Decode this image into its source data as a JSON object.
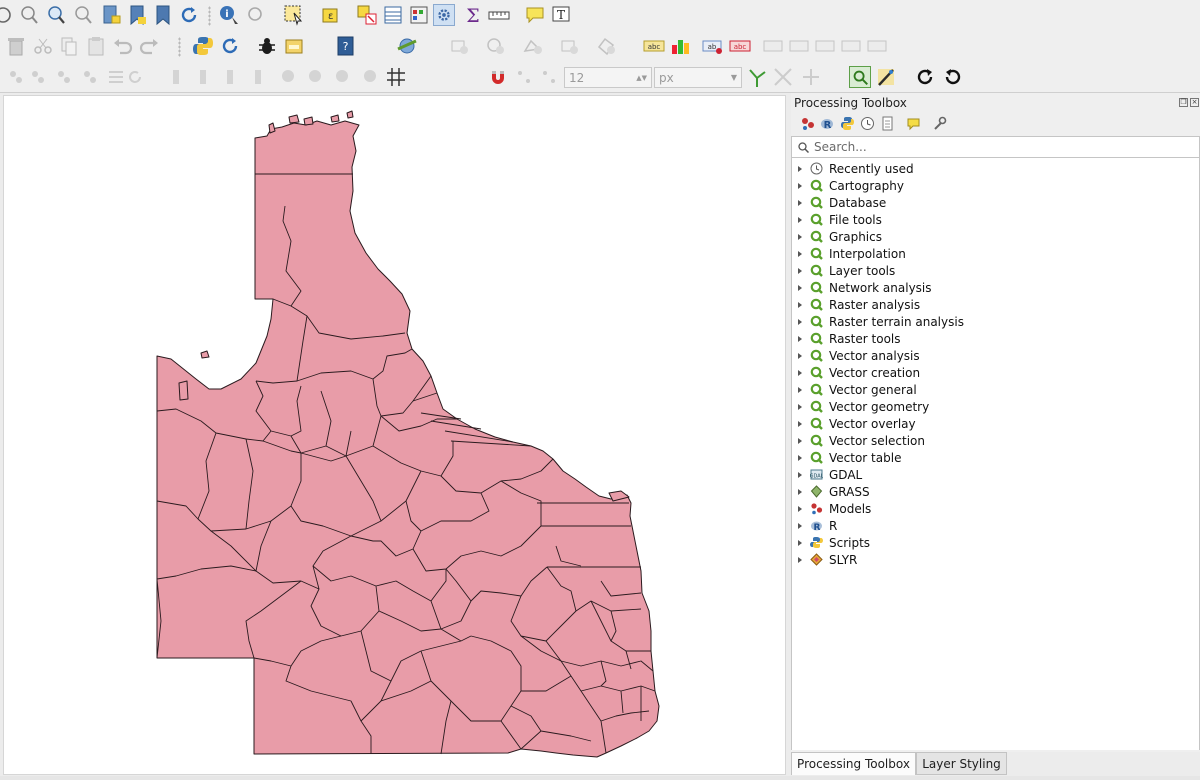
{
  "toolbox": {
    "title": "Processing Toolbox",
    "search_placeholder": "Search...",
    "categories": [
      {
        "label": "Recently used",
        "icon": "clock-icon"
      },
      {
        "label": "Cartography",
        "icon": "qgis-q-icon"
      },
      {
        "label": "Database",
        "icon": "qgis-q-icon"
      },
      {
        "label": "File tools",
        "icon": "qgis-q-icon"
      },
      {
        "label": "Graphics",
        "icon": "qgis-q-icon"
      },
      {
        "label": "Interpolation",
        "icon": "qgis-q-icon"
      },
      {
        "label": "Layer tools",
        "icon": "qgis-q-icon"
      },
      {
        "label": "Network analysis",
        "icon": "qgis-q-icon"
      },
      {
        "label": "Raster analysis",
        "icon": "qgis-q-icon"
      },
      {
        "label": "Raster terrain analysis",
        "icon": "qgis-q-icon"
      },
      {
        "label": "Raster tools",
        "icon": "qgis-q-icon"
      },
      {
        "label": "Vector analysis",
        "icon": "qgis-q-icon"
      },
      {
        "label": "Vector creation",
        "icon": "qgis-q-icon"
      },
      {
        "label": "Vector general",
        "icon": "qgis-q-icon"
      },
      {
        "label": "Vector geometry",
        "icon": "qgis-q-icon"
      },
      {
        "label": "Vector overlay",
        "icon": "qgis-q-icon"
      },
      {
        "label": "Vector selection",
        "icon": "qgis-q-icon"
      },
      {
        "label": "Vector table",
        "icon": "qgis-q-icon"
      },
      {
        "label": "GDAL",
        "icon": "gdal-icon"
      },
      {
        "label": "GRASS",
        "icon": "grass-icon"
      },
      {
        "label": "Models",
        "icon": "models-icon"
      },
      {
        "label": "R",
        "icon": "r-icon"
      },
      {
        "label": "Scripts",
        "icon": "python-icon"
      },
      {
        "label": "SLYR",
        "icon": "slyr-icon"
      }
    ]
  },
  "tabs": {
    "processing": "Processing Toolbox",
    "styling": "Layer Styling"
  },
  "snapping": {
    "tolerance_value": "12",
    "units": "px"
  },
  "colors": {
    "polygon_fill": "#e89ca8",
    "polygon_stroke": "#2a1a1e",
    "qgis_green": "#5aa02c"
  }
}
